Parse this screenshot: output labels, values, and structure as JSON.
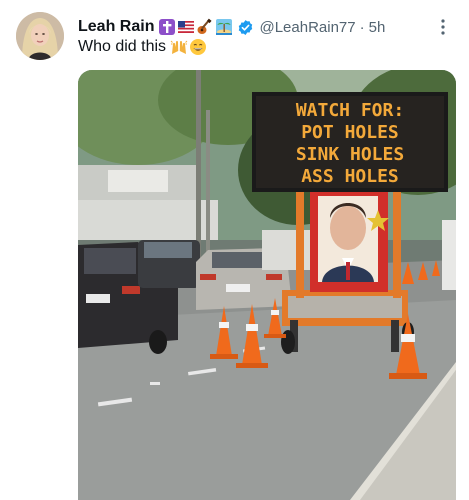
{
  "tweet": {
    "display_name": "Leah Rain",
    "name_emojis": [
      "latin-cross-emoji",
      "us-flag-emoji",
      "guitar-emoji",
      "island-emoji"
    ],
    "verified": true,
    "handle": "@LeahRain77",
    "separator": "·",
    "time": "5h",
    "text": "Who did this",
    "text_emojis": [
      "raised-hands-emoji",
      "grinning-face-emoji"
    ]
  },
  "image": {
    "sign_lines": [
      "WATCH FOR:",
      "POT HOLES",
      "SINK HOLES",
      "ASS HOLES"
    ]
  },
  "colors": {
    "verified_blue": "#1d9bf0",
    "muted_text": "#536471",
    "sign_led": "#f3a93a"
  }
}
